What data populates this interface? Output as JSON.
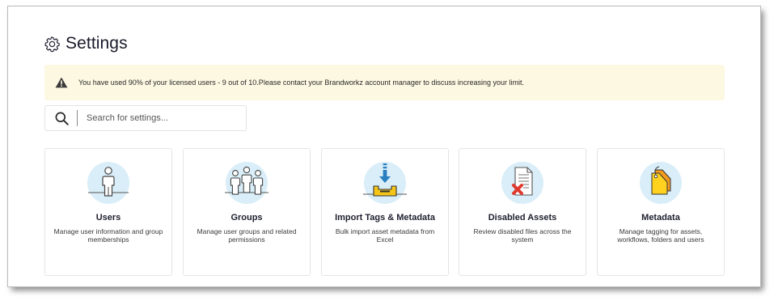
{
  "page": {
    "title": "Settings",
    "title_icon": "gear-icon"
  },
  "alert": {
    "icon": "warning-icon",
    "message": "You have used 90% of your licensed users - 9 out of 10.Please contact your Brandworkz account manager to discuss increasing your limit."
  },
  "search": {
    "icon": "search-icon",
    "placeholder": "Search for settings...",
    "value": ""
  },
  "cards": [
    {
      "title": "Users",
      "description": "Manage user information and group memberships",
      "icon": "user-icon"
    },
    {
      "title": "Groups",
      "description": "Manage user groups and related permissions",
      "icon": "groups-icon"
    },
    {
      "title": "Import Tags & Metadata",
      "description": "Bulk import asset metadata from Excel",
      "icon": "import-tray-icon"
    },
    {
      "title": "Disabled Assets",
      "description": "Review disabled files across the system",
      "icon": "disabled-document-icon"
    },
    {
      "title": "Metadata",
      "description": "Manage tagging for assets, workflows, folders and users",
      "icon": "tags-icon"
    }
  ],
  "colors": {
    "alert_background": "#fdf8e2",
    "icon_circle": "#d9eef8",
    "warning": "#3a3a3a",
    "import_arrow": "#2a7fc0",
    "tray_yellow": "#f5c518",
    "disabled_red": "#e03a2f",
    "tag_orange": "#f39a1f",
    "tag_yellow": "#ffd21f"
  }
}
